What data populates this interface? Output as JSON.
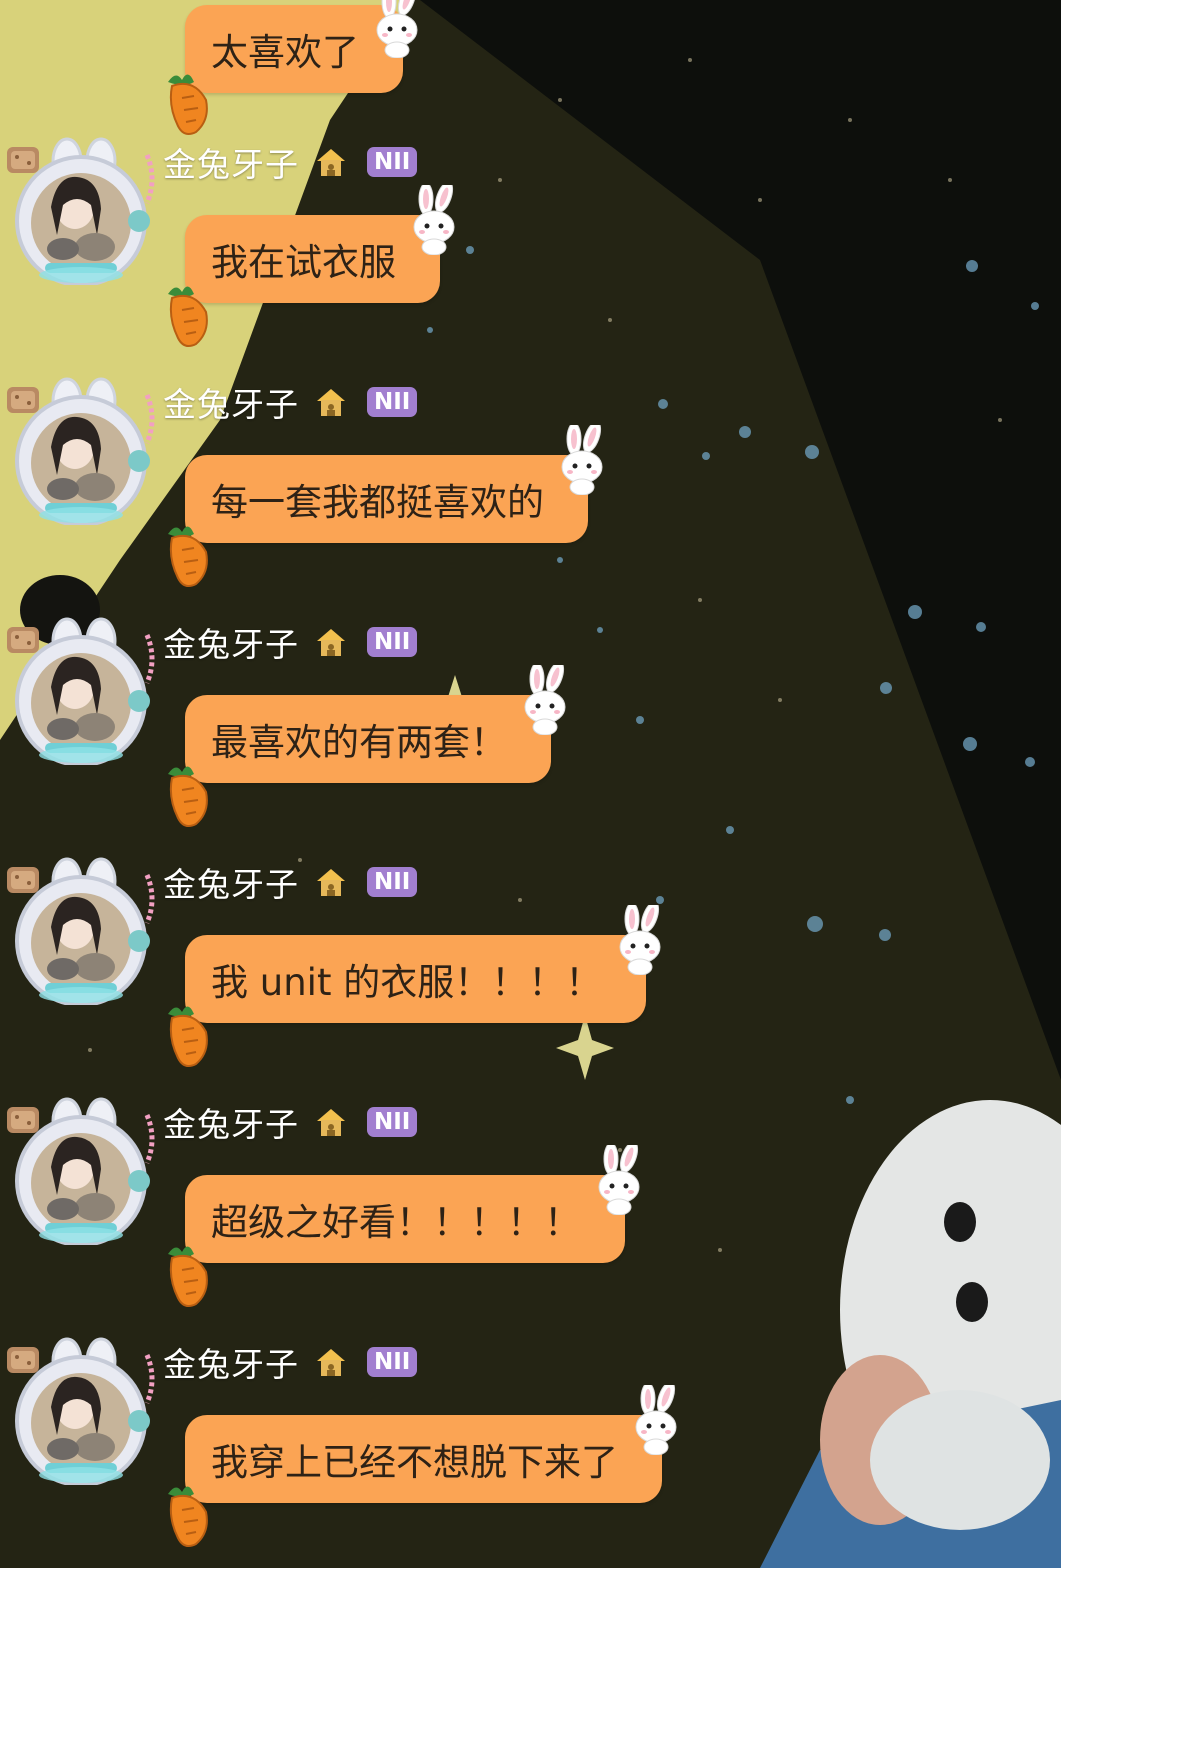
{
  "colors": {
    "bubble": "#fba454",
    "bubble_text": "#2e2216",
    "name_text": "#ffffff",
    "badge_bg": "#a27fd0",
    "background_dark": "#242414",
    "background_yellow": "#d8d27a",
    "starry_sky": "#0d0f0c"
  },
  "icons": {
    "carrot": "carrot-icon",
    "bunny_sticker": "bunny-sticker-icon",
    "house": "house-icon",
    "biscuit": "biscuit-icon"
  },
  "messages": [
    {
      "sender": "",
      "badge": "",
      "text": "太喜欢了"
    },
    {
      "sender": "金兔牙子",
      "badge": "NII",
      "text": "我在试衣服"
    },
    {
      "sender": "金兔牙子",
      "badge": "NII",
      "text": "每一套我都挺喜欢的"
    },
    {
      "sender": "金兔牙子",
      "badge": "NII",
      "text": "最喜欢的有两套！"
    },
    {
      "sender": "金兔牙子",
      "badge": "NII",
      "text": "我 unit 的衣服！！！！"
    },
    {
      "sender": "金兔牙子",
      "badge": "NII",
      "text": "超级之好看！！！！！"
    },
    {
      "sender": "金兔牙子",
      "badge": "NII",
      "text": "我穿上已经不想脱下来了"
    }
  ]
}
